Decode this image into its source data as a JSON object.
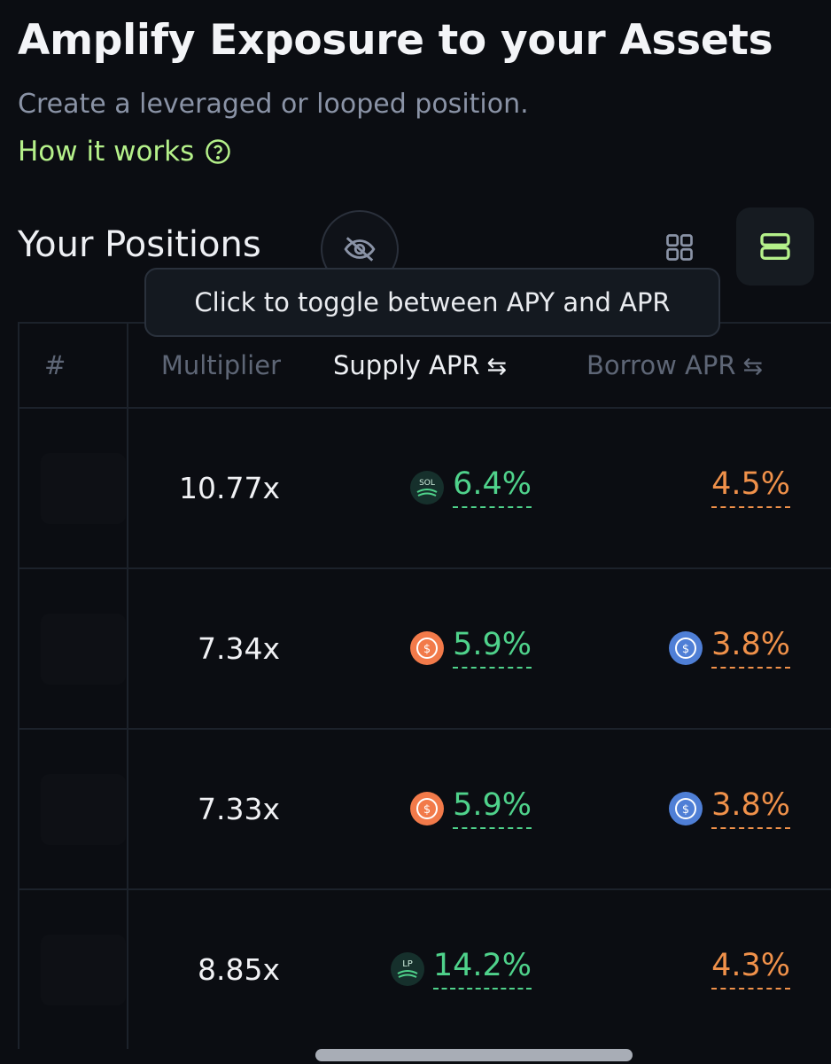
{
  "header": {
    "title": "Amplify Exposure to your Assets",
    "subtitle": "Create a leveraged or looped position.",
    "how_it_works": "How it works"
  },
  "positions": {
    "title": "Your Positions",
    "tooltip": "Click to toggle between APY and APR"
  },
  "table": {
    "headers": {
      "hash": "#",
      "multiplier": "Multiplier",
      "supply": "Supply APR",
      "borrow": "Borrow APR",
      "swap_glyph": "⇆"
    },
    "rows": [
      {
        "multiplier": "10.77x",
        "supply": "6.4%",
        "supply_token": "SOL",
        "borrow": "4.5%",
        "borrow_token": ""
      },
      {
        "multiplier": "7.34x",
        "supply": "5.9%",
        "supply_token": "$",
        "borrow": "3.8%",
        "borrow_token": "$"
      },
      {
        "multiplier": "7.33x",
        "supply": "5.9%",
        "supply_token": "$",
        "borrow": "3.8%",
        "borrow_token": "$"
      },
      {
        "multiplier": "8.85x",
        "supply": "14.2%",
        "supply_token": "LP",
        "borrow": "4.3%",
        "borrow_token": ""
      }
    ]
  },
  "icons": {
    "help": "question-circle-icon",
    "hide": "eye-off-icon",
    "grid": "grid-view-icon",
    "list": "list-view-icon"
  },
  "colors": {
    "background": "#0b0d12",
    "accent_green": "#b5f18a",
    "supply_green": "#4fd28b",
    "borrow_orange": "#f0914a",
    "usdc_orange": "#f27a4a",
    "usdc_blue": "#4f7fd6"
  }
}
